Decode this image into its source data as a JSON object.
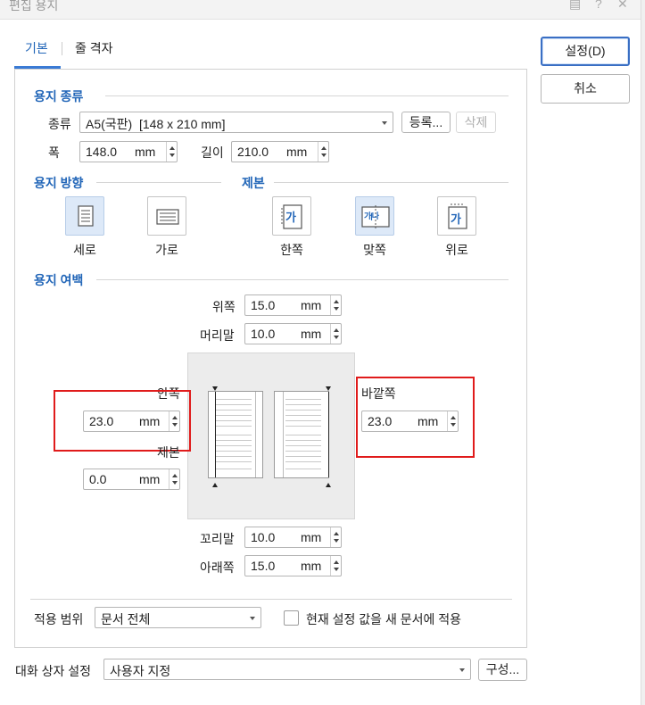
{
  "window": {
    "title": "편집 용지"
  },
  "tabs": [
    {
      "label": "기본"
    },
    {
      "label": "줄 격자"
    }
  ],
  "buttons": {
    "ok": "설정(D)",
    "cancel": "취소",
    "register": "등록...",
    "delete": "삭제",
    "configure": "구성..."
  },
  "paper_type": {
    "section": "용지 종류",
    "kind_label": "종류",
    "kind_value": "A5(국판)  [148 x 210 mm]",
    "width_label": "폭",
    "width_value": "148.0",
    "length_label": "길이",
    "length_value": "210.0",
    "unit": "mm"
  },
  "orientation": {
    "section": "용지 방향",
    "options": [
      {
        "label": "세로",
        "selected": true
      },
      {
        "label": "가로",
        "selected": false
      }
    ]
  },
  "binding": {
    "section": "제본",
    "options": [
      {
        "label": "한쪽",
        "glyph": "가",
        "selected": false
      },
      {
        "label": "맞쪽",
        "glyph": "가|나",
        "selected": true
      },
      {
        "label": "위로",
        "glyph": "가",
        "selected": false
      }
    ]
  },
  "margins": {
    "section": "용지 여백",
    "top": {
      "label": "위쪽",
      "value": "15.0"
    },
    "header": {
      "label": "머리말",
      "value": "10.0"
    },
    "inner": {
      "label": "안쪽",
      "value": "23.0"
    },
    "gutter": {
      "label": "제본",
      "value": "0.0"
    },
    "outer": {
      "label": "바깥쪽",
      "value": "23.0"
    },
    "footer": {
      "label": "꼬리말",
      "value": "10.0"
    },
    "bottom": {
      "label": "아래쪽",
      "value": "15.0"
    },
    "unit": "mm"
  },
  "apply": {
    "label": "적용 범위",
    "value": "문서 전체",
    "checkbox_label": "현재 설정 값을 새 문서에 적용"
  },
  "dialog_settings": {
    "label": "대화 상자 설정",
    "value": "사용자 지정"
  },
  "colors": {
    "accent": "#2266b8",
    "highlight": "#e01b1b"
  }
}
